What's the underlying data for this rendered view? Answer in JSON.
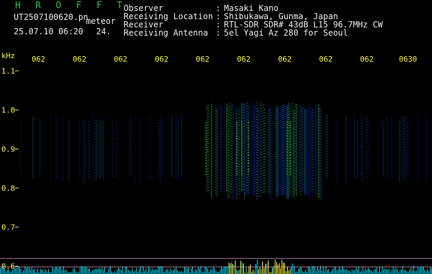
{
  "header": {
    "title": "H R O F F T",
    "filename": "UT2507100620.pn",
    "mode": "meteor",
    "timestamp": "25.07.10 06:20",
    "value": "24.",
    "info": [
      {
        "label": "Observer",
        "value": "Masaki Kano"
      },
      {
        "label": "Receiving Location",
        "value": "Shibukawa, Gunma, Japan"
      },
      {
        "label": "Receiver",
        "value": "RTL-SDR SDR# 43dB L15 96.7MHz CW"
      },
      {
        "label": "Receiving Antenna",
        "value": "5el Yagi Az 280 for Seoul"
      }
    ]
  },
  "chart_data": {
    "type": "heatmap",
    "ylabel": "kHz",
    "y_ticks": [
      "1.1",
      "1.0",
      "0.9",
      "0.8",
      "0.7",
      "0.6"
    ],
    "ylim": [
      0.58,
      1.15
    ],
    "x_ticks": [
      "062",
      "062",
      "062",
      "062",
      "062",
      "062",
      "062",
      "062",
      "062",
      "0630"
    ],
    "colors": {
      "background": "#000000",
      "signal_low": "#1a3cff",
      "signal_mid": "#00e5ff",
      "signal_high": "#33ff33",
      "signal_peak": "#ffff33",
      "ref_line": "#b07aa0",
      "axis_tick": "#ffff33"
    }
  }
}
